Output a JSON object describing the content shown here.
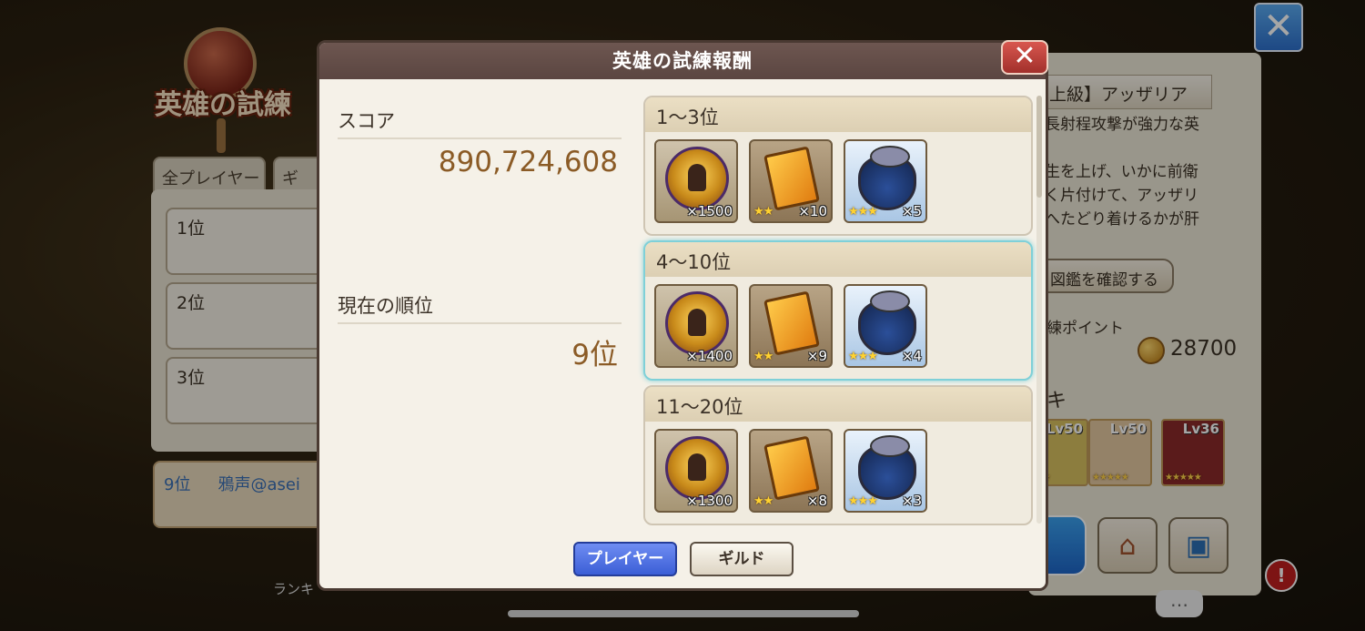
{
  "background": {
    "logo_text": "英雄の試練",
    "tabs": [
      "全プレイヤー",
      "ギ"
    ],
    "rank_rows": [
      "1位",
      "2位",
      "3位"
    ],
    "my_rank": {
      "rank": "9位",
      "name": "鴉声@asei"
    },
    "bottom_text": "ランキ",
    "boss_title": "上級】アッザリア",
    "boss_desc": [
      "長射程攻撃が強力な英",
      "",
      "生を上げ、いかに前衛",
      "く片付けて、アッザリ",
      "へたどり着けるかが肝"
    ],
    "zukan_button": "図鑑を確認する",
    "points_label": "練ポイント",
    "points_value": "28700",
    "deck_label": "キ",
    "hero_cards": [
      {
        "lv": "Lv50",
        "stars": "★★★",
        "color": "#d8c060"
      },
      {
        "lv": "Lv50",
        "stars": "★★★★★",
        "color": "#e4c8a0"
      },
      {
        "lv": "Lv36",
        "stars": "★★★★★",
        "color": "#8a2a2a"
      }
    ]
  },
  "modal": {
    "title": "英雄の試練報酬",
    "score_label": "スコア",
    "score_value": "890,724,608",
    "rank_label": "現在の順位",
    "rank_value": "9位",
    "tiers": [
      {
        "label": "1〜3位",
        "medal_qty": "×1500",
        "book_stars": "★★",
        "book_qty": "×10",
        "bag_stars": "★★★",
        "bag_qty": "×5"
      },
      {
        "label": "4〜10位",
        "medal_qty": "×1400",
        "book_stars": "★★",
        "book_qty": "×9",
        "bag_stars": "★★★",
        "bag_qty": "×4"
      },
      {
        "label": "11〜20位",
        "medal_qty": "×1300",
        "book_stars": "★★",
        "book_qty": "×8",
        "bag_stars": "★★★",
        "bag_qty": "×3"
      }
    ],
    "player_button": "プレイヤー",
    "guild_button": "ギルド"
  }
}
